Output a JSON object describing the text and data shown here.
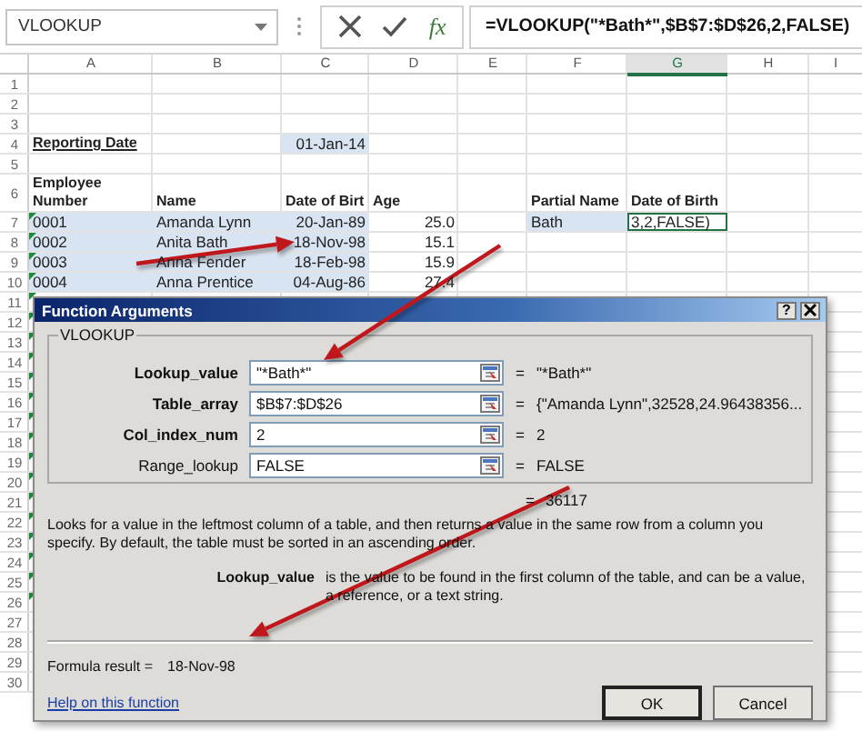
{
  "name_box": {
    "value": "VLOOKUP"
  },
  "formula_bar": {
    "function_button": "fx",
    "formula": "=VLOOKUP(\"*Bath*\",$B$7:$D$26,2,FALSE)"
  },
  "sheet": {
    "columns": [
      {
        "label": "A",
        "selected": false
      },
      {
        "label": "B",
        "selected": false
      },
      {
        "label": "C",
        "selected": false
      },
      {
        "label": "D",
        "selected": false
      },
      {
        "label": "E",
        "selected": false
      },
      {
        "label": "F",
        "selected": false
      },
      {
        "label": "G",
        "selected": true
      },
      {
        "label": "H",
        "selected": false
      },
      {
        "label": "I",
        "selected": false
      }
    ],
    "rows": [
      {
        "number": "1"
      },
      {
        "number": "2"
      },
      {
        "number": "3"
      },
      {
        "number": "4",
        "cells": [
          {
            "text": "Reporting Date",
            "kind": "heading",
            "selected": false,
            "active": false,
            "flag": false
          },
          null,
          {
            "text": "01-Jan-14",
            "kind": "number",
            "selected": true,
            "active": false,
            "flag": false
          }
        ]
      },
      {
        "number": "5"
      },
      {
        "number": "6",
        "cells": [
          {
            "text": "Employee Number",
            "kind": "wrapped",
            "selected": false,
            "active": false,
            "flag": false
          },
          {
            "text": "Name",
            "kind": "bold",
            "selected": false,
            "active": false,
            "flag": false
          },
          {
            "text": "Date of Birt",
            "kind": "bold",
            "selected": false,
            "active": false,
            "flag": false
          },
          {
            "text": "Age",
            "kind": "bold",
            "selected": false,
            "active": false,
            "flag": false
          },
          null,
          {
            "text": "Partial Name",
            "kind": "bold",
            "selected": false,
            "active": false,
            "flag": false
          },
          {
            "text": "Date of Birth",
            "kind": "bold",
            "selected": false,
            "active": false,
            "flag": false
          }
        ]
      },
      {
        "number": "7",
        "cells": [
          {
            "text": "0001",
            "kind": "text",
            "selected": true,
            "active": false,
            "flag": true
          },
          {
            "text": "Amanda Lynn",
            "kind": "text",
            "selected": true,
            "active": false,
            "flag": false
          },
          {
            "text": "20-Jan-89",
            "kind": "number",
            "selected": true,
            "active": false,
            "flag": false
          },
          {
            "text": "25.0",
            "kind": "number",
            "selected": false,
            "active": false,
            "flag": false
          },
          null,
          {
            "text": "Bath",
            "kind": "text",
            "selected": true,
            "active": false,
            "flag": false
          },
          {
            "text": "3,2,FALSE)",
            "kind": "text",
            "selected": false,
            "active": true,
            "flag": false
          }
        ]
      },
      {
        "number": "8",
        "cells": [
          {
            "text": "0002",
            "kind": "text",
            "selected": true,
            "active": false,
            "flag": true
          },
          {
            "text": "Anita Bath",
            "kind": "text",
            "selected": true,
            "active": false,
            "flag": false
          },
          {
            "text": "18-Nov-98",
            "kind": "number",
            "selected": true,
            "active": false,
            "flag": false
          },
          {
            "text": "15.1",
            "kind": "number",
            "selected": false,
            "active": false,
            "flag": false
          }
        ]
      },
      {
        "number": "9",
        "cells": [
          {
            "text": "0003",
            "kind": "text",
            "selected": true,
            "active": false,
            "flag": true
          },
          {
            "text": "Anna Fender",
            "kind": "text",
            "selected": true,
            "active": false,
            "flag": false
          },
          {
            "text": "18-Feb-98",
            "kind": "number",
            "selected": true,
            "active": false,
            "flag": false
          },
          {
            "text": "15.9",
            "kind": "number",
            "selected": false,
            "active": false,
            "flag": false
          }
        ]
      },
      {
        "number": "10",
        "cells": [
          {
            "text": "0004",
            "kind": "text",
            "selected": true,
            "active": false,
            "flag": true
          },
          {
            "text": "Anna Prentice",
            "kind": "text",
            "selected": true,
            "active": false,
            "flag": false
          },
          {
            "text": "04-Aug-86",
            "kind": "number",
            "selected": true,
            "active": false,
            "flag": false
          },
          {
            "text": "27.4",
            "kind": "number",
            "selected": false,
            "active": false,
            "flag": false
          }
        ]
      },
      {
        "number": "11",
        "cells": [
          {
            "flag": true
          }
        ]
      },
      {
        "number": "12",
        "cells": [
          {
            "flag": true
          }
        ]
      },
      {
        "number": "13",
        "cells": [
          {
            "flag": true
          }
        ]
      },
      {
        "number": "14",
        "cells": [
          {
            "flag": true
          }
        ]
      },
      {
        "number": "15",
        "cells": [
          {
            "flag": true
          }
        ]
      },
      {
        "number": "16",
        "cells": [
          {
            "flag": true
          }
        ]
      },
      {
        "number": "17",
        "cells": [
          {
            "flag": true
          }
        ]
      },
      {
        "number": "18",
        "cells": [
          {
            "flag": true
          }
        ]
      },
      {
        "number": "19",
        "cells": [
          {
            "flag": true
          }
        ]
      },
      {
        "number": "20",
        "cells": [
          {
            "flag": true
          }
        ]
      },
      {
        "number": "21",
        "cells": [
          {
            "flag": true
          }
        ]
      },
      {
        "number": "22",
        "cells": [
          {
            "flag": true
          }
        ]
      },
      {
        "number": "23",
        "cells": [
          {
            "flag": true
          }
        ]
      },
      {
        "number": "24",
        "cells": [
          {
            "flag": true
          }
        ]
      },
      {
        "number": "25",
        "cells": [
          {
            "flag": true
          }
        ]
      },
      {
        "number": "26",
        "cells": [
          {
            "flag": true
          }
        ]
      },
      {
        "number": "27"
      },
      {
        "number": "28"
      },
      {
        "number": "29"
      },
      {
        "number": "30"
      }
    ]
  },
  "dialog": {
    "title": "Function Arguments",
    "help_button": "?",
    "group": "VLOOKUP",
    "arguments": [
      {
        "label": "Lookup_value",
        "required": true,
        "value": "\"*Bath*\"",
        "equals": "=",
        "result": "\"*Bath*\""
      },
      {
        "label": "Table_array",
        "required": true,
        "value": "$B$7:$D$26",
        "equals": "=",
        "result": "{\"Amanda Lynn\",32528,24.96438356..."
      },
      {
        "label": "Col_index_num",
        "required": true,
        "value": "2",
        "equals": "=",
        "result": "2"
      },
      {
        "label": "Range_lookup",
        "required": false,
        "value": "FALSE",
        "equals": "=",
        "result": "FALSE"
      }
    ],
    "total": {
      "equals": "=",
      "result": "36117"
    },
    "description": "Looks for a value in the leftmost column of a table, and then returns a value in the same row from a column you specify. By default, the table must be sorted in an ascending order.",
    "argument_help": {
      "name": "Lookup_value",
      "text": "is the value to be found in the first column of the table, and can be a value, a reference, or a text string."
    },
    "formula_result": {
      "label": "Formula result =",
      "value": "18-Nov-98"
    },
    "help_link": "Help on this function",
    "buttons": [
      {
        "label": "OK",
        "default": true
      },
      {
        "label": "Cancel",
        "default": false
      }
    ]
  }
}
